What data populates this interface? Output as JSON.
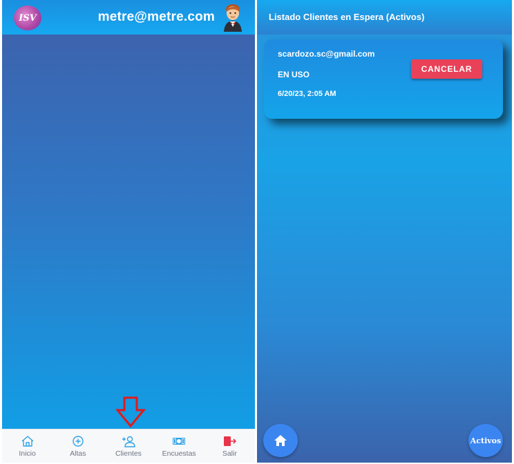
{
  "left": {
    "header": {
      "logo_text": "ISV",
      "user_email": "metre@metre.com"
    },
    "tabbar": {
      "items": [
        {
          "label": "Inicio",
          "icon": "home-icon"
        },
        {
          "label": "Altas",
          "icon": "add-circle-icon"
        },
        {
          "label": "Clientes",
          "icon": "add-person-icon"
        },
        {
          "label": "Encuestas",
          "icon": "cash-icon"
        },
        {
          "label": "Salir",
          "icon": "exit-icon"
        }
      ]
    },
    "annotation": {
      "icon": "down-arrow-icon",
      "color": "#e01b1b"
    }
  },
  "right": {
    "header": {
      "title": "Listado Clientes en Espera (Activos)"
    },
    "card": {
      "email": "scardozo.sc@gmail.com",
      "status": "EN USO",
      "date": "6/20/23, 2:05 AM",
      "cancel_label": "CANCELAR"
    },
    "fab": {
      "home_icon": "home-icon",
      "activos_label": "Activos"
    }
  },
  "colors": {
    "accent": "#1aa2e6",
    "cancel": "#e94158",
    "fab": "#3a85f0",
    "tab_icon": "#2fa2e6",
    "exit_icon": "#e8354a"
  }
}
